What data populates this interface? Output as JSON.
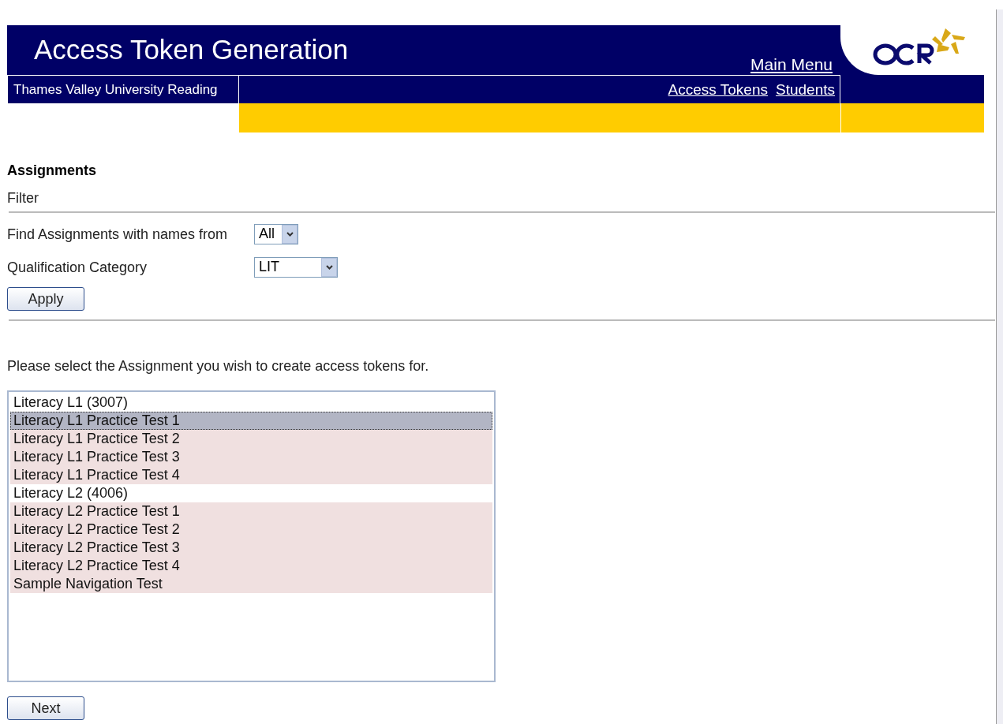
{
  "header": {
    "title": "Access Token Generation",
    "main_menu": "Main Menu",
    "centre": "Thames Valley University Reading",
    "links": [
      "Access Tokens",
      "Students"
    ]
  },
  "section_title": "Assignments",
  "filter": {
    "title": "Filter",
    "fields": [
      {
        "label": "Find Assignments with names from",
        "value": "All"
      },
      {
        "label": "Qualification Category",
        "value": "LIT"
      }
    ],
    "apply": "Apply"
  },
  "prompt": "Please select the Assignment you wish to create access tokens for.",
  "assignments": [
    {
      "label": "Literacy L1 (3007)",
      "kind": "group",
      "selected": false
    },
    {
      "label": "Literacy L1 Practice Test 1",
      "kind": "option",
      "selected": true
    },
    {
      "label": "Literacy L1 Practice Test 2",
      "kind": "option",
      "selected": false
    },
    {
      "label": "Literacy L1 Practice Test 3",
      "kind": "option",
      "selected": false
    },
    {
      "label": "Literacy L1 Practice Test 4",
      "kind": "option",
      "selected": false
    },
    {
      "label": "Literacy L2 (4006)",
      "kind": "group",
      "selected": false
    },
    {
      "label": "Literacy L2 Practice Test 1",
      "kind": "option",
      "selected": false
    },
    {
      "label": "Literacy L2 Practice Test 2",
      "kind": "option",
      "selected": false
    },
    {
      "label": "Literacy L2 Practice Test 3",
      "kind": "option",
      "selected": false
    },
    {
      "label": "Literacy L2 Practice Test 4",
      "kind": "option",
      "selected": false
    },
    {
      "label": "Sample Navigation Test",
      "kind": "option",
      "selected": false
    }
  ],
  "next": "Next"
}
